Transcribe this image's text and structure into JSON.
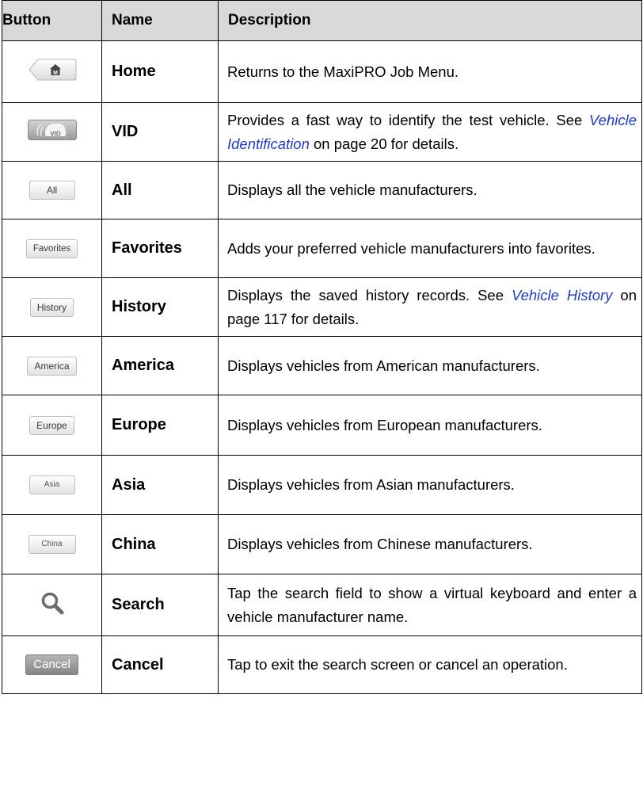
{
  "header": {
    "button": "Button",
    "name": "Name",
    "description": "Description"
  },
  "rows": [
    {
      "icon": "home-icon",
      "icon_text": "M",
      "name": "Home",
      "desc": "Returns to the MaxiPRO Job Menu."
    },
    {
      "icon": "vid-car-icon",
      "icon_text": "VID",
      "name": "VID",
      "desc_pre": "Provides a fast way to identify the test vehicle. See ",
      "desc_link": "Vehicle Identification",
      "desc_post": " on page 20 for details."
    },
    {
      "icon": "all-button-icon",
      "icon_text": "All",
      "name": "All",
      "desc": "Displays all the vehicle manufacturers."
    },
    {
      "icon": "favorites-button-icon",
      "icon_text": "Favorites",
      "name": "Favorites",
      "desc": "Adds your preferred vehicle manufacturers into favorites."
    },
    {
      "icon": "history-button-icon",
      "icon_text": "History",
      "name": "History",
      "desc_pre": "Displays the saved history records. See ",
      "desc_link": "Vehicle History",
      "desc_post": " on page 117 for details."
    },
    {
      "icon": "america-button-icon",
      "icon_text": "America",
      "name": "America",
      "desc": "Displays vehicles from American manufacturers."
    },
    {
      "icon": "europe-button-icon",
      "icon_text": "Europe",
      "name": "Europe",
      "desc": "Displays vehicles from European manufacturers."
    },
    {
      "icon": "asia-button-icon",
      "icon_text": "Asia",
      "name": "Asia",
      "desc": "Displays vehicles from Asian manufacturers."
    },
    {
      "icon": "china-button-icon",
      "icon_text": "China",
      "name": "China",
      "desc": "Displays vehicles from Chinese manufacturers."
    },
    {
      "icon": "search-icon",
      "name": "Search",
      "desc": "Tap the search field to show a virtual keyboard and enter a vehicle manufacturer name."
    },
    {
      "icon": "cancel-button-icon",
      "icon_text": "Cancel",
      "name": "Cancel",
      "desc": "Tap to exit the search screen or cancel an operation."
    }
  ]
}
